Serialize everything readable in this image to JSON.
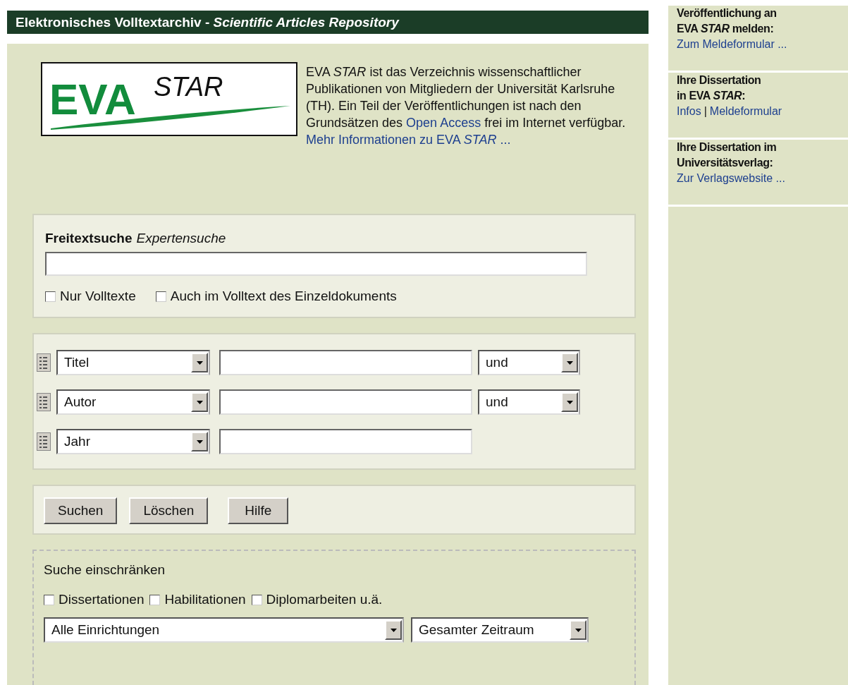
{
  "header": {
    "title": "Elektronisches Volltextarchiv - ",
    "subtitle": "Scientific Articles Repository"
  },
  "logo": {
    "main": "EVA",
    "sub": "STAR"
  },
  "intro": [
    {
      "kind": "text",
      "text": "EVA *STAR* ist das Verzeichnis wissenschaftlicher Publikationen von Mitgliedern der Universität Karlsruhe (TH). Ein Teil der Veröffentlichungen ist nach den Grundsätzen des "
    },
    {
      "kind": "link",
      "text": "Open Access"
    },
    {
      "kind": "text",
      "text": " frei im Internet verfügbar. "
    },
    {
      "kind": "link",
      "text": "Mehr Informationen zu EVA *STAR* ..."
    }
  ],
  "freitext": {
    "label": "Freitextsuche",
    "expert_link": "Expertensuche",
    "checkboxes": [
      {
        "label": "Nur Volltexte",
        "checked": false
      },
      {
        "label": "Auch im Volltext des Einzeldokuments",
        "checked": false
      }
    ]
  },
  "field_rows": [
    {
      "field": "Titel",
      "operator": "und"
    },
    {
      "field": "Autor",
      "operator": "und"
    },
    {
      "field": "Jahr"
    }
  ],
  "buttons": [
    "Suchen",
    "Löschen",
    "Hilfe"
  ],
  "restrict": {
    "title": "Suche einschränken",
    "checkboxes": [
      {
        "label": "Dissertationen",
        "checked": false
      },
      {
        "label": "Habilitationen",
        "checked": false
      },
      {
        "label": "Diplomarbeiten u.ä.",
        "checked": false
      }
    ],
    "institution": "Alle Einrichtungen",
    "period": "Gesamter Zeitraum"
  },
  "sidebar": [
    {
      "heading_lines": [
        "Veröffentlichung an",
        "EVA *STAR* melden:"
      ],
      "links": [
        "Zum Meldeformular ..."
      ]
    },
    {
      "heading_lines": [
        "Ihre Dissertation",
        "in EVA *STAR*:"
      ],
      "links": [
        "Infos",
        "Meldeformular"
      ],
      "separator": "|"
    },
    {
      "heading_lines": [
        "Ihre Dissertation im",
        "Universitätsverlag:"
      ],
      "links": [
        "Zur Verlagswebsite ..."
      ]
    }
  ]
}
